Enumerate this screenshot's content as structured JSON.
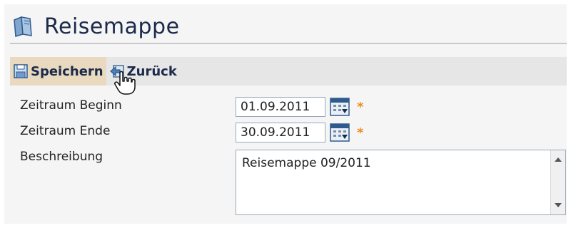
{
  "header": {
    "title": "Reisemappe",
    "icon": "travel-folder-icon"
  },
  "toolbar": {
    "save_label": "Speichern",
    "back_label": "Zurück",
    "save_icon": "save-icon",
    "back_icon": "back-arrow-icon"
  },
  "form": {
    "start": {
      "label": "Zeitraum Beginn",
      "value": "01.09.2011",
      "required_mark": "*"
    },
    "end": {
      "label": "Zeitraum Ende",
      "value": "30.09.2011",
      "required_mark": "*"
    },
    "description": {
      "label": "Beschreibung",
      "value": "Reisemappe 09/2011"
    }
  },
  "colors": {
    "title": "#1b2a4a",
    "toolbar_bg": "#e6e6e6",
    "active_button_bg": "#e8d9bf",
    "required": "#f08a1a"
  }
}
